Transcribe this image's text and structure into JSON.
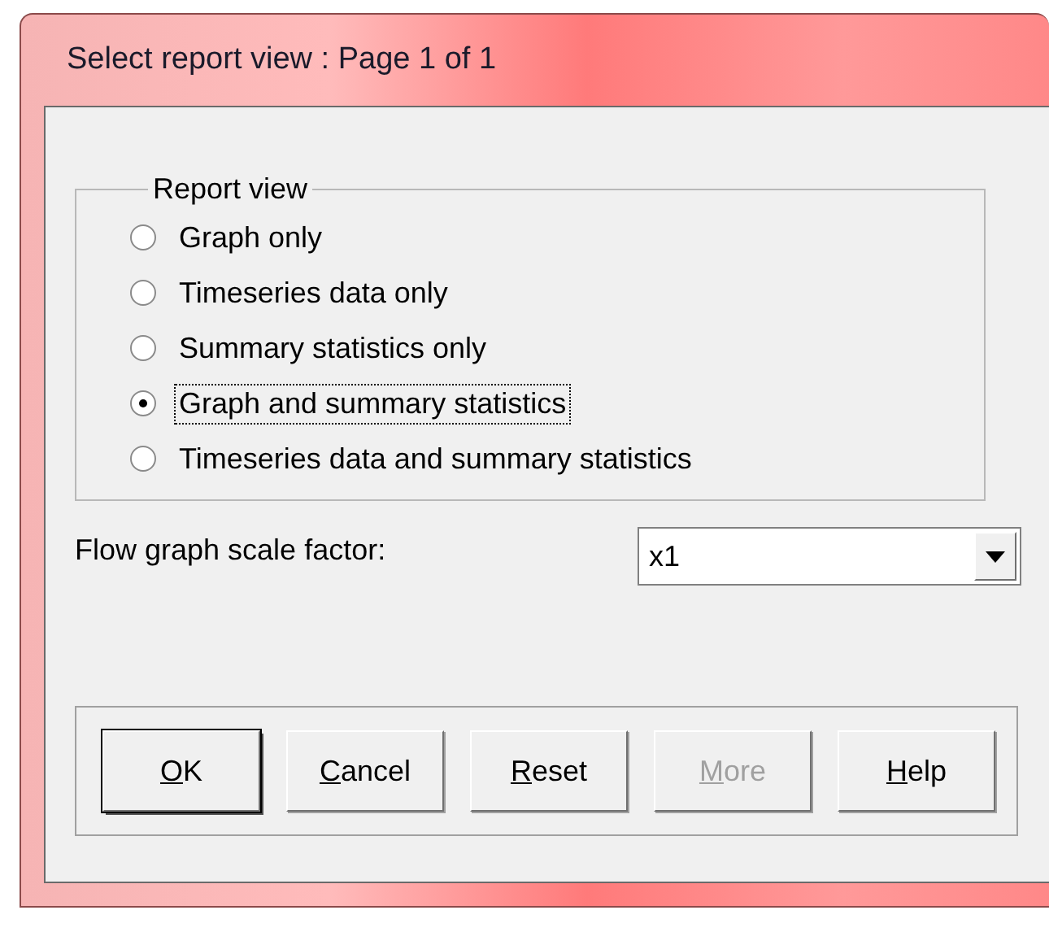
{
  "window": {
    "title": "Select report view : Page 1 of 1"
  },
  "report_view": {
    "legend": "Report view",
    "options": [
      {
        "label": "Graph only",
        "selected": false,
        "focused": false
      },
      {
        "label": "Timeseries data only",
        "selected": false,
        "focused": false
      },
      {
        "label": "Summary statistics only",
        "selected": false,
        "focused": false
      },
      {
        "label": "Graph and summary statistics",
        "selected": true,
        "focused": true
      },
      {
        "label": "Timeseries data and summary statistics",
        "selected": false,
        "focused": false
      }
    ]
  },
  "scale_factor": {
    "label": "Flow graph scale factor:",
    "value": "x1"
  },
  "buttons": [
    {
      "label": "OK",
      "underline_first": true,
      "default": true,
      "disabled": false
    },
    {
      "label": "Cancel",
      "underline_first": true,
      "default": false,
      "disabled": false
    },
    {
      "label": "Reset",
      "underline_first": true,
      "default": false,
      "disabled": false
    },
    {
      "label": "More",
      "underline_first": true,
      "default": false,
      "disabled": true
    },
    {
      "label": "Help",
      "underline_first": true,
      "default": false,
      "disabled": false
    }
  ]
}
